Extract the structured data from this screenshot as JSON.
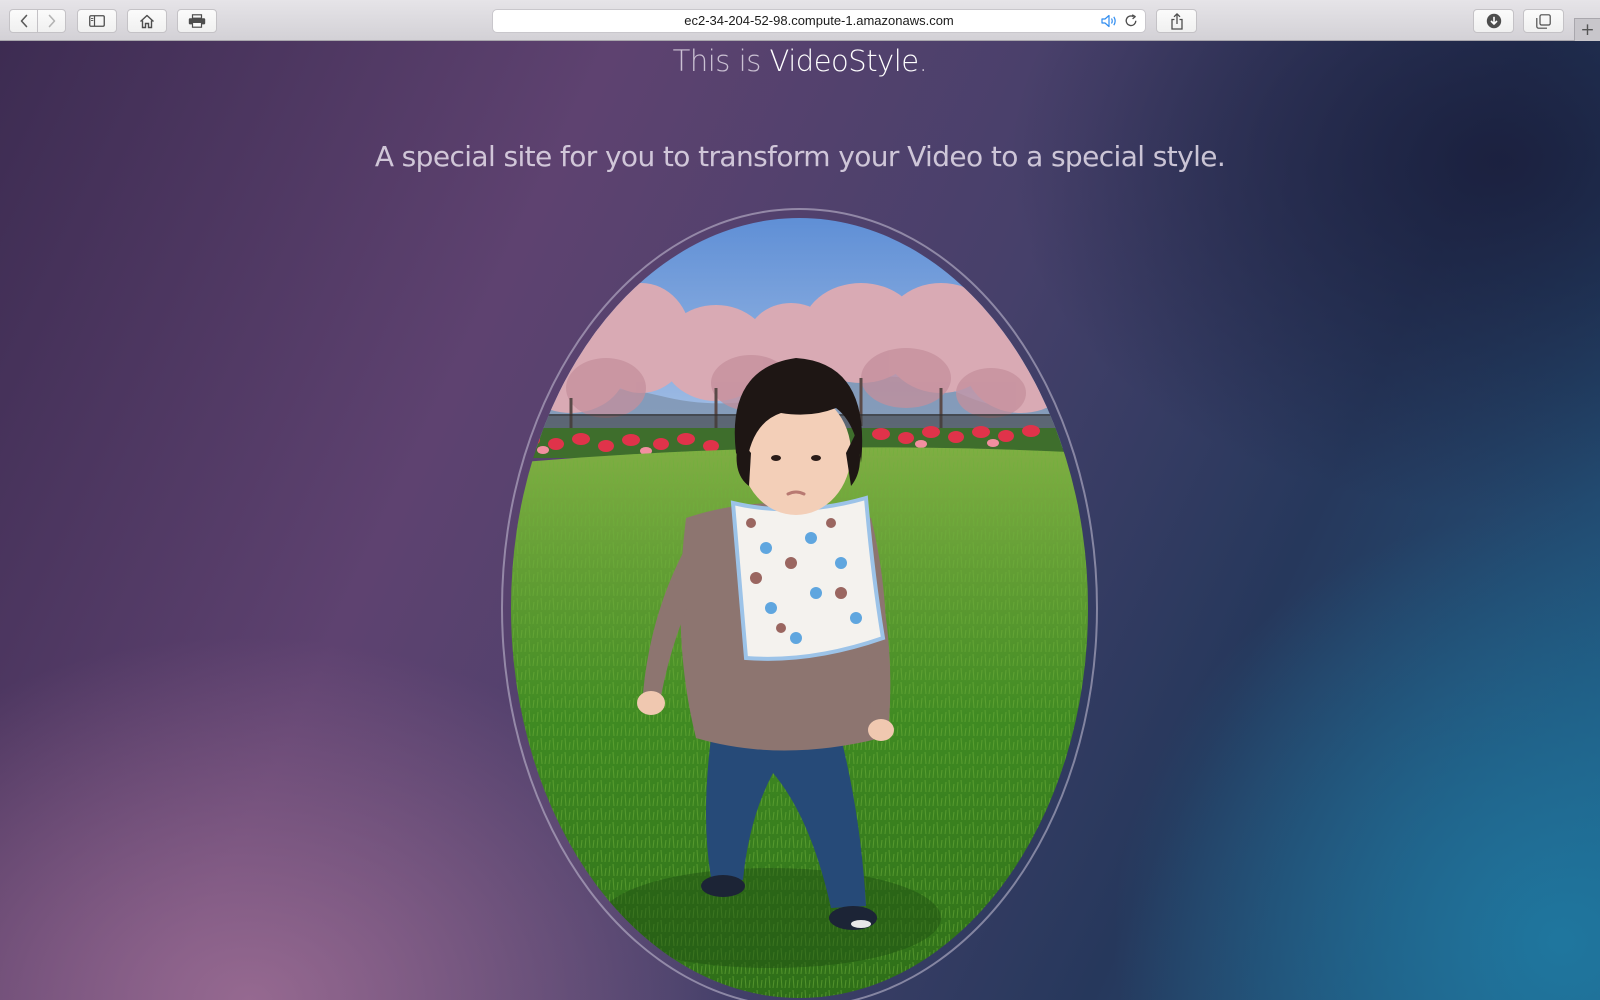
{
  "browser": {
    "url": "ec2-34-204-52-98.compute-1.amazonaws.com",
    "icons": {
      "back": "chevron-left-icon",
      "forward": "chevron-right-icon",
      "sidebar": "sidebar-icon",
      "home": "home-icon",
      "print": "printer-icon",
      "audio": "speaker-icon",
      "reload": "reload-icon",
      "share": "share-icon",
      "downloads": "download-icon",
      "tabs": "tabs-overview-icon",
      "new_tab": "plus-icon"
    },
    "new_tab_symbol": "+"
  },
  "page": {
    "headline_prefix": "This is ",
    "headline_brand": "VideoStyle",
    "headline_suffix": ".",
    "tagline": "A special site for you to transform your Video to a special style.",
    "colors": {
      "brand_text": "#ffffff",
      "text": "#e8e2ee",
      "bg_purple": "#5e4270",
      "bg_blue": "#1f5c84"
    }
  }
}
